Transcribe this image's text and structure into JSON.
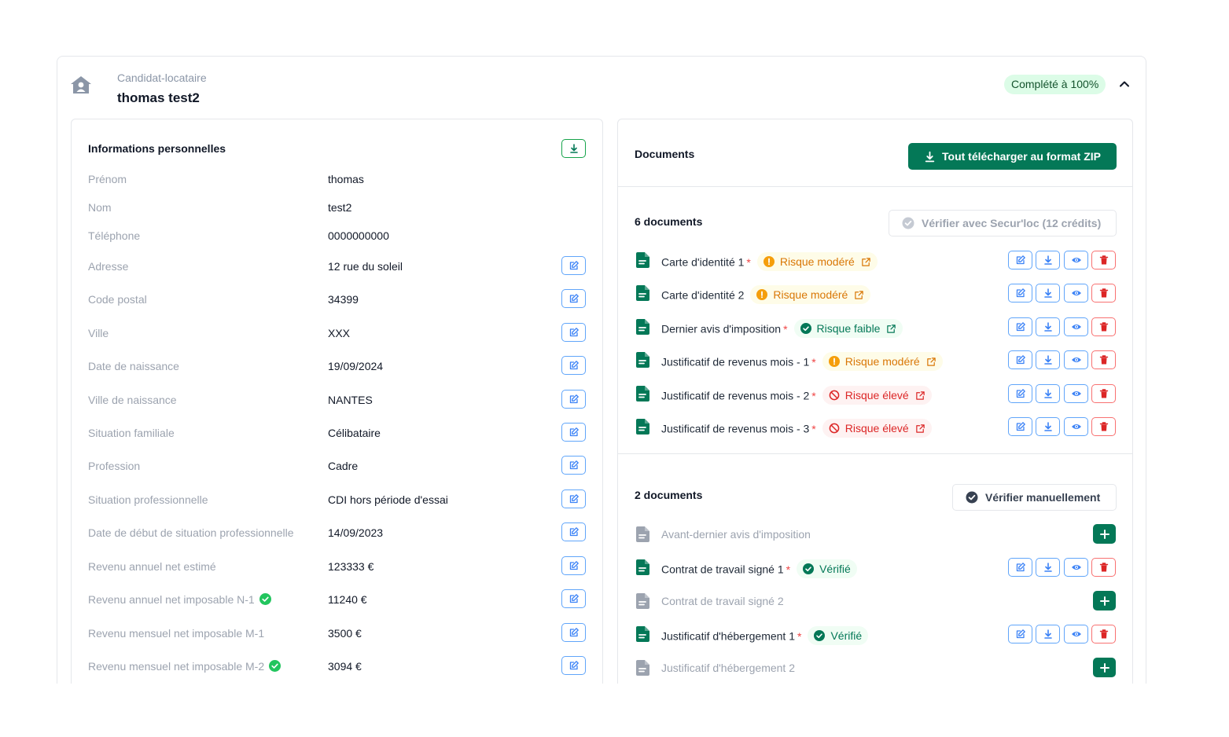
{
  "header": {
    "subtitle": "Candidat-locataire",
    "name": "thomas test2",
    "completion_badge": "Complété à 100%"
  },
  "personal_info": {
    "title": "Informations personnelles",
    "rows": [
      {
        "label": "Prénom",
        "value": "thomas",
        "editable": false,
        "verified": false
      },
      {
        "label": "Nom",
        "value": "test2",
        "editable": false,
        "verified": false
      },
      {
        "label": "Téléphone",
        "value": "0000000000",
        "editable": false,
        "verified": false
      },
      {
        "label": "Adresse",
        "value": "12 rue du soleil",
        "editable": true,
        "verified": false
      },
      {
        "label": "Code postal",
        "value": "34399",
        "editable": true,
        "verified": false
      },
      {
        "label": "Ville",
        "value": "XXX",
        "editable": true,
        "verified": false
      },
      {
        "label": "Date de naissance",
        "value": "19/09/2024",
        "editable": true,
        "verified": false
      },
      {
        "label": "Ville de naissance",
        "value": "NANTES",
        "editable": true,
        "verified": false
      },
      {
        "label": "Situation familiale",
        "value": "Célibataire",
        "editable": true,
        "verified": false
      },
      {
        "label": "Profession",
        "value": "Cadre",
        "editable": true,
        "verified": false
      },
      {
        "label": "Situation professionnelle",
        "value": "CDI hors période d'essai",
        "editable": true,
        "verified": false
      },
      {
        "label": "Date de début de situation professionnelle",
        "value": "14/09/2023",
        "editable": true,
        "verified": false
      },
      {
        "label": "Revenu annuel net estimé",
        "value": "123333 €",
        "editable": true,
        "verified": false
      },
      {
        "label": "Revenu annuel net imposable N-1",
        "value": "11240 €",
        "editable": true,
        "verified": true
      },
      {
        "label": "Revenu mensuel net imposable M-1",
        "value": "3500 €",
        "editable": true,
        "verified": false
      },
      {
        "label": "Revenu mensuel net imposable M-2",
        "value": "3094 €",
        "editable": true,
        "verified": true
      }
    ]
  },
  "documents": {
    "title": "Documents",
    "zip_button": "Tout télécharger au format ZIP",
    "group1": {
      "count_label": "6 documents",
      "verify_button": "Vérifier avec Secur'loc (12 crédits)",
      "items": [
        {
          "name": "Carte d'identité 1",
          "required": true,
          "risk": "moderate",
          "risk_label": "Risque modéré"
        },
        {
          "name": "Carte d'identité 2",
          "required": false,
          "risk": "moderate",
          "risk_label": "Risque modéré"
        },
        {
          "name": "Dernier avis d'imposition",
          "required": true,
          "risk": "low",
          "risk_label": "Risque faible"
        },
        {
          "name": "Justificatif de revenus mois - 1",
          "required": true,
          "risk": "moderate",
          "risk_label": "Risque modéré"
        },
        {
          "name": "Justificatif de revenus mois - 2",
          "required": true,
          "risk": "high",
          "risk_label": "Risque élevé"
        },
        {
          "name": "Justificatif de revenus mois - 3",
          "required": true,
          "risk": "high",
          "risk_label": "Risque élevé"
        }
      ]
    },
    "group2": {
      "count_label": "2 documents",
      "verify_button": "Vérifier manuellement",
      "items": [
        {
          "name": "Avant-dernier avis d'imposition",
          "present": false,
          "required": false,
          "status_label": ""
        },
        {
          "name": "Contrat de travail signé 1",
          "present": true,
          "required": true,
          "status_label": "Vérifié"
        },
        {
          "name": "Contrat de travail signé 2",
          "present": false,
          "required": false,
          "status_label": ""
        },
        {
          "name": "Justificatif d'hébergement 1",
          "present": true,
          "required": true,
          "status_label": "Vérifié"
        },
        {
          "name": "Justificatif d'hébergement 2",
          "present": false,
          "required": false,
          "status_label": ""
        }
      ]
    },
    "required_marker": "*"
  },
  "colors": {
    "brand_green": "#047857",
    "risk_moderate": "#d97706",
    "risk_high": "#dc2626",
    "risk_low": "#047857",
    "edit_blue": "#3b82f6"
  }
}
